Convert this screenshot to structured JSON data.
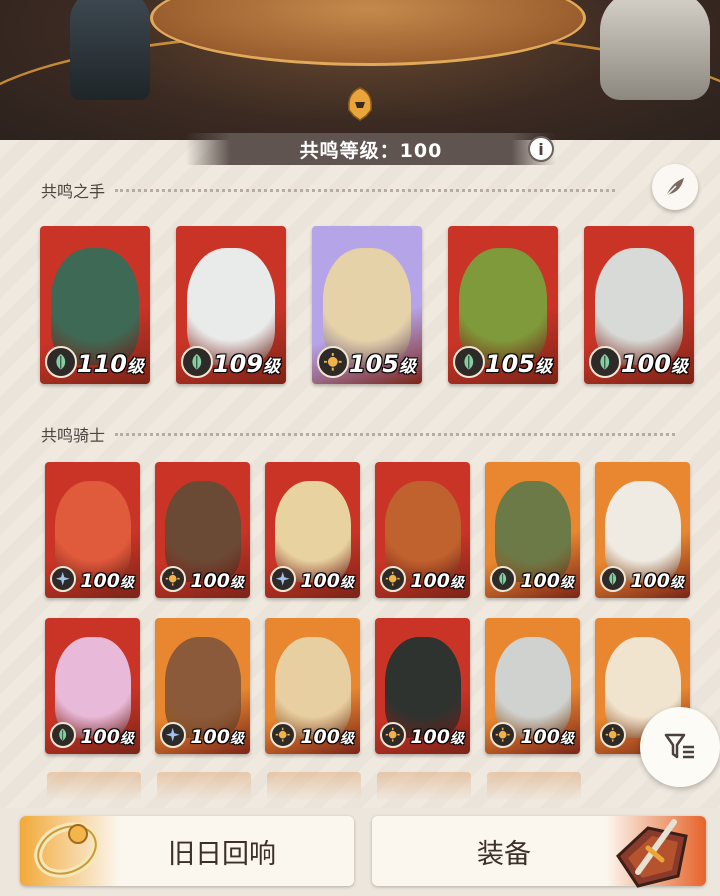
{
  "colors": {
    "panel_bg": "#ece6dc",
    "level_bar": "#5f5450",
    "card_red": "#c63a2c",
    "card_orange": "#e8872f",
    "card_purple": "#b9a7e6"
  },
  "header": {
    "level_label": "共鸣等级：100",
    "info_icon": "i"
  },
  "hands": {
    "title": "共鸣之手",
    "icon": "feather-icon",
    "cards": [
      {
        "level": "110",
        "unit": "级",
        "faction": "leaf",
        "bg": "#c93427",
        "portrait": "#3e6a55"
      },
      {
        "level": "109",
        "unit": "级",
        "faction": "leaf",
        "bg": "#c93427",
        "portrait": "#e9eaea"
      },
      {
        "level": "105",
        "unit": "级",
        "faction": "sun",
        "bg": "#b6a4e8",
        "portrait": "#e6d2a8"
      },
      {
        "level": "105",
        "unit": "级",
        "faction": "leaf",
        "bg": "#c93427",
        "portrait": "#7f9a3a"
      },
      {
        "level": "100",
        "unit": "级",
        "faction": "leaf",
        "bg": "#c93427",
        "portrait": "#d7dad6"
      }
    ]
  },
  "knights": {
    "title": "共鸣骑士",
    "rows": [
      [
        {
          "level": "100",
          "unit": "级",
          "faction": "star",
          "bg": "#c93427",
          "portrait": "#e05a3c"
        },
        {
          "level": "100",
          "unit": "级",
          "faction": "sun",
          "bg": "#c93427",
          "portrait": "#6b4a35"
        },
        {
          "level": "100",
          "unit": "级",
          "faction": "star",
          "bg": "#c93427",
          "portrait": "#e8d2a0"
        },
        {
          "level": "100",
          "unit": "级",
          "faction": "sun",
          "bg": "#c93427",
          "portrait": "#c0622e"
        },
        {
          "level": "100",
          "unit": "级",
          "faction": "leaf",
          "bg": "#e8872f",
          "portrait": "#6c7a48"
        },
        {
          "level": "100",
          "unit": "级",
          "faction": "leaf",
          "bg": "#e8872f",
          "portrait": "#efeae2"
        }
      ],
      [
        {
          "level": "100",
          "unit": "级",
          "faction": "leaf",
          "bg": "#c93427",
          "portrait": "#e8b9d8"
        },
        {
          "level": "100",
          "unit": "级",
          "faction": "star",
          "bg": "#e8872f",
          "portrait": "#8a5a3a"
        },
        {
          "level": "100",
          "unit": "级",
          "faction": "sun",
          "bg": "#e8872f",
          "portrait": "#e8cfa2"
        },
        {
          "level": "100",
          "unit": "级",
          "faction": "sun",
          "bg": "#c93427",
          "portrait": "#2e3330"
        },
        {
          "level": "100",
          "unit": "级",
          "faction": "sun",
          "bg": "#e8872f",
          "portrait": "#cfd2cf"
        },
        {
          "level": "1",
          "unit": "",
          "faction": "sun",
          "bg": "#e8872f",
          "portrait": "#f1e4cf"
        }
      ]
    ]
  },
  "filter": {
    "icon": "filter-icon"
  },
  "bottom_tabs": {
    "left_label": "旧日回响",
    "right_label": "装备",
    "left_icon": "ring-icon",
    "right_icon": "sword-icon"
  }
}
